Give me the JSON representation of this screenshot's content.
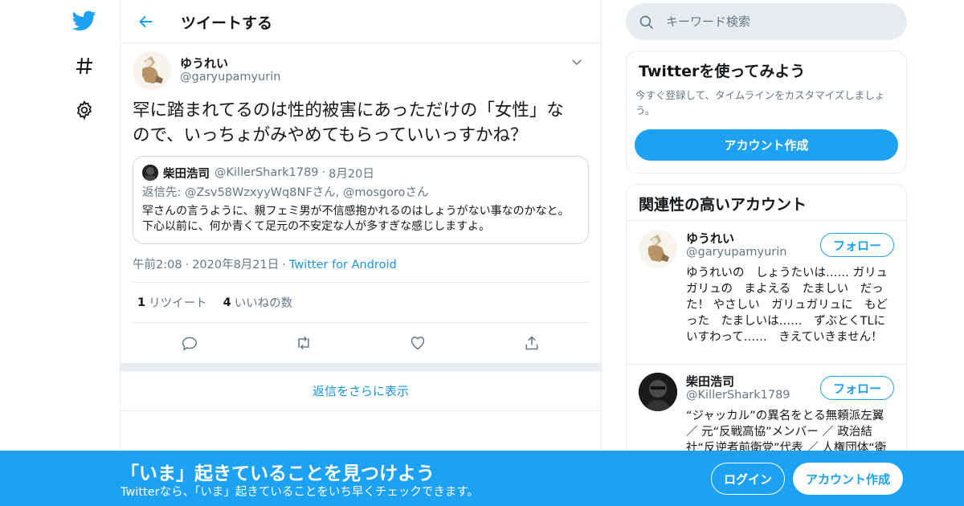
{
  "nav": {
    "logo_icon": "twitter-bird-icon",
    "explore_icon": "hashtag-icon",
    "settings_icon": "gear-icon",
    "brand_color": "#1da1f2"
  },
  "header": {
    "title": "ツイートする",
    "back_icon": "back-arrow-icon"
  },
  "tweet": {
    "author_name": "ゆうれい",
    "author_handle": "@garyupamyurin",
    "text": "罕に踏まれてるのは性的被害にあっただけの「女性」なので、いっちょがみやめてもらっていいっすかね？",
    "quote": {
      "name": "柴田浩司",
      "handle": "@KillerShark1789",
      "dot": "·",
      "date": "8月20日",
      "reply_to": "返信先: @Zsv58WzxyyWq8NFさん, @mosgoroさん",
      "text": "罕さんの言うように、親フェミ男が不信感抱かれるのはしょうがない事なのかなと。下心以前に、何か青くて足元の不安定な人が多すぎな感じしますよ。"
    },
    "time": "午前2:08",
    "dot": "·",
    "date": "2020年8月21日",
    "source": "Twitter for Android",
    "retweet_count": "1",
    "retweet_label": "リツイート",
    "like_count": "4",
    "like_label": "いいねの数"
  },
  "more_replies": "返信をさらに表示",
  "search": {
    "placeholder": "キーワード検索"
  },
  "signup_card": {
    "title": "Twitterを使ってみよう",
    "text": "今すぐ登録して、タイムラインをカスタマイズしましょう。",
    "button": "アカウント作成"
  },
  "related": {
    "title": "関連性の高いアカウント",
    "accounts": [
      {
        "name": "ゆうれい",
        "handle": "@garyupamyurin",
        "follow": "フォロー",
        "bio": "ゆうれいの　しょうたいは…… ガリュガリュの　まよえる　たましい　だった！ やさしい　ガリュガリュに　もどった　たましいは……　ずぶとくTLにいすわって……　きえていきません！"
      },
      {
        "name": "柴田浩司",
        "handle": "@KillerShark1789",
        "follow": "フォロー",
        "bio": "“ジャッカル”の異名をとる無頼派左翼 ／ 元“反戦高協”メンバー ／ 政治結社“反逆者前衛党”代表 ／ 人権団体“衛"
      }
    ]
  },
  "banner": {
    "title": "「いま」起きていることを見つけよう",
    "subtitle": "Twitterなら、「いま」起きていることをいち早くチェックできます。",
    "login": "ログイン",
    "signup": "アカウント作成"
  }
}
